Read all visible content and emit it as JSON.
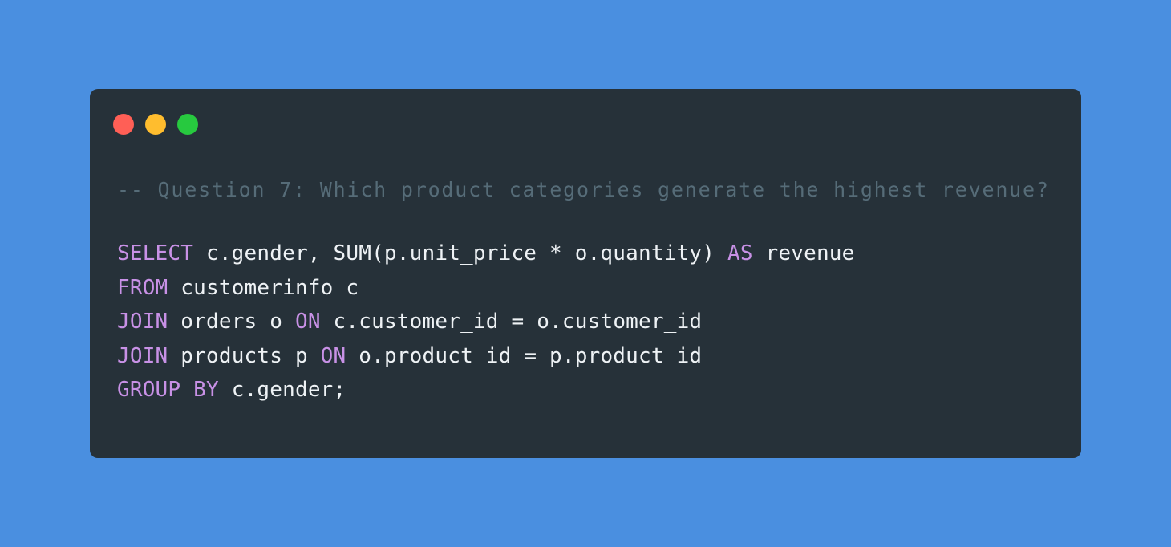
{
  "colors": {
    "background": "#4a8fe0",
    "window": "#263139",
    "dot_red": "#ff5f56",
    "dot_yellow": "#ffbd2e",
    "dot_green": "#27c93f",
    "keyword": "#c891e6",
    "text": "#eef2f5",
    "comment": "#566c78"
  },
  "window_controls": [
    "close-dot",
    "minimize-dot",
    "maximize-dot"
  ],
  "code": {
    "comment": "-- Question 7: Which product categories generate the highest revenue?",
    "lines": [
      [
        {
          "t": "kw",
          "v": "SELECT"
        },
        {
          "t": "tx",
          "v": " c.gender, SUM(p.unit_price * o.quantity) "
        },
        {
          "t": "kw",
          "v": "AS"
        },
        {
          "t": "tx",
          "v": " revenue"
        }
      ],
      [
        {
          "t": "kw",
          "v": "FROM"
        },
        {
          "t": "tx",
          "v": " customerinfo c"
        }
      ],
      [
        {
          "t": "kw",
          "v": "JOIN"
        },
        {
          "t": "tx",
          "v": " orders o "
        },
        {
          "t": "kw",
          "v": "ON"
        },
        {
          "t": "tx",
          "v": " c.customer_id = o.customer_id"
        }
      ],
      [
        {
          "t": "kw",
          "v": "JOIN"
        },
        {
          "t": "tx",
          "v": " products p "
        },
        {
          "t": "kw",
          "v": "ON"
        },
        {
          "t": "tx",
          "v": " o.product_id = p.product_id"
        }
      ],
      [
        {
          "t": "kw",
          "v": "GROUP"
        },
        {
          "t": "tx",
          "v": " "
        },
        {
          "t": "kw",
          "v": "BY"
        },
        {
          "t": "tx",
          "v": " c.gender;"
        }
      ]
    ]
  }
}
